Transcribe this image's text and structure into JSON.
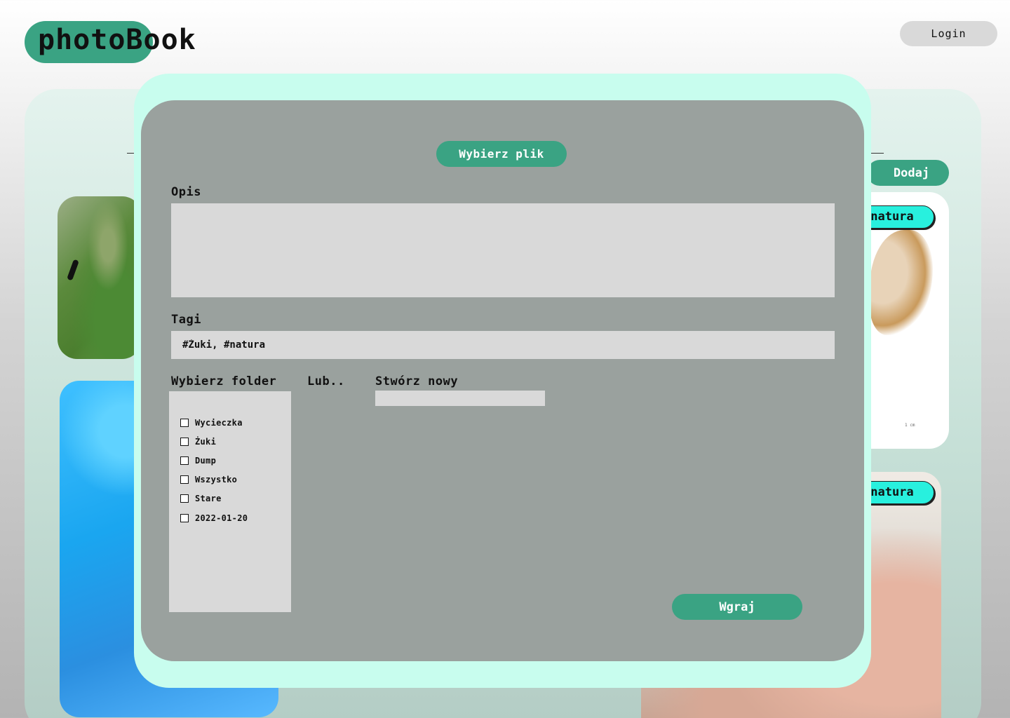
{
  "header": {
    "logo": "photoBook",
    "login_label": "Login"
  },
  "board": {
    "add_label": "Dodaj",
    "tags": [
      "#natura",
      "#natura"
    ],
    "scale_label": "1 cm"
  },
  "modal": {
    "choose_file_label": "Wybierz plik",
    "description_label": "Opis",
    "description_value": "",
    "tags_label": "Tagi",
    "tags_value": "#Żuki, #natura",
    "choose_folder_label": "Wybierz folder",
    "or_label": "Lub..",
    "create_new_label": "Stwórz nowy",
    "new_folder_value": "",
    "folders": [
      {
        "label": "Wycieczka",
        "checked": false
      },
      {
        "label": "Żuki",
        "checked": false
      },
      {
        "label": "Dump",
        "checked": false
      },
      {
        "label": "Wszystko",
        "checked": false
      },
      {
        "label": "Stare",
        "checked": false
      },
      {
        "label": "2022-01-20",
        "checked": false
      }
    ],
    "upload_label": "Wgraj"
  },
  "colors": {
    "accent": "#3aa383",
    "modal_outer": "#c8fdee",
    "modal_inner": "#9aa19e",
    "field": "#d9d9d9",
    "tag": "#28f0de"
  }
}
